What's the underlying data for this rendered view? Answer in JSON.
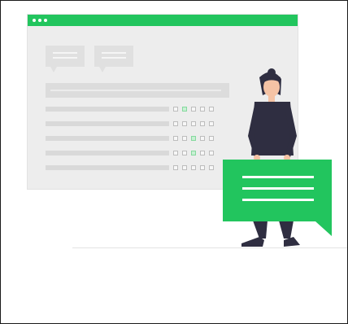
{
  "colors": {
    "accent": "#22c55e",
    "panel": "#ededed",
    "skin": "#f5c3a5",
    "dark": "#2f2e41"
  },
  "form": {
    "rows": [
      [
        false,
        true,
        false,
        false,
        false
      ],
      [
        false,
        false,
        false,
        false,
        false
      ],
      [
        false,
        false,
        true,
        false,
        false
      ],
      [
        false,
        false,
        true,
        false,
        false
      ],
      [
        false,
        false,
        false,
        false,
        false
      ]
    ]
  },
  "icons": {
    "person": "person-holding-chat-icon",
    "speech": "speech-bubble-icon"
  }
}
